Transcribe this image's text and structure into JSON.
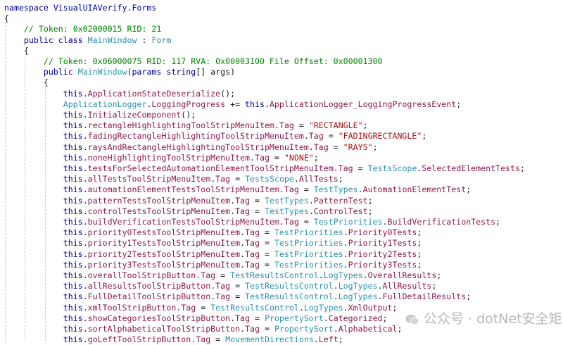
{
  "colors": {
    "keyword": "#00008b",
    "comment": "#008000",
    "type": "#2b91af",
    "namespace_type": "#0000a0",
    "member": "#8b1a4b",
    "string": "#a31515",
    "background": "#ffffff",
    "watermark": "#b8b8b8"
  },
  "watermark": {
    "icon": "wechat-icon",
    "text": "公众号 · dotNet安全矩阵"
  },
  "lines": [
    [
      [
        "kw",
        "namespace"
      ],
      [
        "p",
        " "
      ],
      [
        "tp",
        "VisualUIAVerify.Forms"
      ]
    ],
    [
      [
        "p",
        "{"
      ]
    ],
    [
      [
        "p",
        "    "
      ],
      [
        "cmt",
        "// Token: 0x02000015 RID: 21"
      ]
    ],
    [
      [
        "p",
        "    "
      ],
      [
        "kw",
        "public class"
      ],
      [
        "p",
        " "
      ],
      [
        "ty",
        "MainWindow"
      ],
      [
        "p",
        " : "
      ],
      [
        "ty",
        "Form"
      ]
    ],
    [
      [
        "p",
        "    {"
      ]
    ],
    [
      [
        "p",
        "        "
      ],
      [
        "cmt",
        "// Token: 0x06000075 RID: 117 RVA: 0x00003100 File Offset: 0x00001300"
      ]
    ],
    [
      [
        "p",
        "        "
      ],
      [
        "kw",
        "public"
      ],
      [
        "p",
        " "
      ],
      [
        "ty",
        "MainWindow"
      ],
      [
        "p",
        "("
      ],
      [
        "kw",
        "params string"
      ],
      [
        "p",
        "[] args)"
      ]
    ],
    [
      [
        "p",
        "        {"
      ]
    ],
    [
      [
        "p",
        "            "
      ],
      [
        "kw",
        "this"
      ],
      [
        "p",
        "."
      ],
      [
        "mem",
        "ApplicationStateDeserialize"
      ],
      [
        "p",
        "();"
      ]
    ],
    [
      [
        "p",
        "            "
      ],
      [
        "ty",
        "ApplicationLogger"
      ],
      [
        "p",
        "."
      ],
      [
        "mem",
        "LoggingProgress"
      ],
      [
        "p",
        " += "
      ],
      [
        "kw",
        "this"
      ],
      [
        "p",
        "."
      ],
      [
        "mem",
        "ApplicationLogger_LoggingProgressEvent"
      ],
      [
        "p",
        ";"
      ]
    ],
    [
      [
        "p",
        "            "
      ],
      [
        "kw",
        "this"
      ],
      [
        "p",
        "."
      ],
      [
        "mem",
        "InitializeComponent"
      ],
      [
        "p",
        "();"
      ]
    ],
    [
      [
        "p",
        "            "
      ],
      [
        "kw",
        "this"
      ],
      [
        "p",
        "."
      ],
      [
        "mem",
        "rectangleHighlightingToolStripMenuItem"
      ],
      [
        "p",
        "."
      ],
      [
        "mem",
        "Tag"
      ],
      [
        "p",
        " = "
      ],
      [
        "str",
        "\"RECTANGLE\""
      ],
      [
        "p",
        ";"
      ]
    ],
    [
      [
        "p",
        "            "
      ],
      [
        "kw",
        "this"
      ],
      [
        "p",
        "."
      ],
      [
        "mem",
        "fadingRectangleHighlightingToolStripMenuItem"
      ],
      [
        "p",
        "."
      ],
      [
        "mem",
        "Tag"
      ],
      [
        "p",
        " = "
      ],
      [
        "str",
        "\"FADINGRECTANGLE\""
      ],
      [
        "p",
        ";"
      ]
    ],
    [
      [
        "p",
        "            "
      ],
      [
        "kw",
        "this"
      ],
      [
        "p",
        "."
      ],
      [
        "mem",
        "raysAndRectangleHighlightingToolStripMenuItem"
      ],
      [
        "p",
        "."
      ],
      [
        "mem",
        "Tag"
      ],
      [
        "p",
        " = "
      ],
      [
        "str",
        "\"RAYS\""
      ],
      [
        "p",
        ";"
      ]
    ],
    [
      [
        "p",
        "            "
      ],
      [
        "kw",
        "this"
      ],
      [
        "p",
        "."
      ],
      [
        "mem",
        "noneHighlightingToolStripMenuItem"
      ],
      [
        "p",
        "."
      ],
      [
        "mem",
        "Tag"
      ],
      [
        "p",
        " = "
      ],
      [
        "str",
        "\"NONE\""
      ],
      [
        "p",
        ";"
      ]
    ],
    [
      [
        "p",
        "            "
      ],
      [
        "kw",
        "this"
      ],
      [
        "p",
        "."
      ],
      [
        "mem",
        "testsForSelectedAutomationElementToolStripMenuItem"
      ],
      [
        "p",
        "."
      ],
      [
        "mem",
        "Tag"
      ],
      [
        "p",
        " = "
      ],
      [
        "ty",
        "TestsScope"
      ],
      [
        "p",
        "."
      ],
      [
        "mem",
        "SelectedElementTests"
      ],
      [
        "p",
        ";"
      ]
    ],
    [
      [
        "p",
        "            "
      ],
      [
        "kw",
        "this"
      ],
      [
        "p",
        "."
      ],
      [
        "mem",
        "allTestsToolStripMenuItem"
      ],
      [
        "p",
        "."
      ],
      [
        "mem",
        "Tag"
      ],
      [
        "p",
        " = "
      ],
      [
        "ty",
        "TestsScope"
      ],
      [
        "p",
        "."
      ],
      [
        "mem",
        "AllTests"
      ],
      [
        "p",
        ";"
      ]
    ],
    [
      [
        "p",
        "            "
      ],
      [
        "kw",
        "this"
      ],
      [
        "p",
        "."
      ],
      [
        "mem",
        "automationElementTestsToolStripMenuItem"
      ],
      [
        "p",
        "."
      ],
      [
        "mem",
        "Tag"
      ],
      [
        "p",
        " = "
      ],
      [
        "ty",
        "TestTypes"
      ],
      [
        "p",
        "."
      ],
      [
        "mem",
        "AutomationElementTest"
      ],
      [
        "p",
        ";"
      ]
    ],
    [
      [
        "p",
        "            "
      ],
      [
        "kw",
        "this"
      ],
      [
        "p",
        "."
      ],
      [
        "mem",
        "patternTestsToolStripMenuItem"
      ],
      [
        "p",
        "."
      ],
      [
        "mem",
        "Tag"
      ],
      [
        "p",
        " = "
      ],
      [
        "ty",
        "TestTypes"
      ],
      [
        "p",
        "."
      ],
      [
        "mem",
        "PatternTest"
      ],
      [
        "p",
        ";"
      ]
    ],
    [
      [
        "p",
        "            "
      ],
      [
        "kw",
        "this"
      ],
      [
        "p",
        "."
      ],
      [
        "mem",
        "controlTestsToolStripMenuItem"
      ],
      [
        "p",
        "."
      ],
      [
        "mem",
        "Tag"
      ],
      [
        "p",
        " = "
      ],
      [
        "ty",
        "TestTypes"
      ],
      [
        "p",
        "."
      ],
      [
        "mem",
        "ControlTest"
      ],
      [
        "p",
        ";"
      ]
    ],
    [
      [
        "p",
        "            "
      ],
      [
        "kw",
        "this"
      ],
      [
        "p",
        "."
      ],
      [
        "mem",
        "buildVerificationTestsToolStripMenuItem"
      ],
      [
        "p",
        "."
      ],
      [
        "mem",
        "Tag"
      ],
      [
        "p",
        " = "
      ],
      [
        "ty",
        "TestPriorities"
      ],
      [
        "p",
        "."
      ],
      [
        "mem",
        "BuildVerificationTests"
      ],
      [
        "p",
        ";"
      ]
    ],
    [
      [
        "p",
        "            "
      ],
      [
        "kw",
        "this"
      ],
      [
        "p",
        "."
      ],
      [
        "mem",
        "priority0TestsToolStripMenuItem"
      ],
      [
        "p",
        "."
      ],
      [
        "mem",
        "Tag"
      ],
      [
        "p",
        " = "
      ],
      [
        "ty",
        "TestPriorities"
      ],
      [
        "p",
        "."
      ],
      [
        "mem",
        "Priority0Tests"
      ],
      [
        "p",
        ";"
      ]
    ],
    [
      [
        "p",
        "            "
      ],
      [
        "kw",
        "this"
      ],
      [
        "p",
        "."
      ],
      [
        "mem",
        "priority1TestsToolStripMenuItem"
      ],
      [
        "p",
        "."
      ],
      [
        "mem",
        "Tag"
      ],
      [
        "p",
        " = "
      ],
      [
        "ty",
        "TestPriorities"
      ],
      [
        "p",
        "."
      ],
      [
        "mem",
        "Priority1Tests"
      ],
      [
        "p",
        ";"
      ]
    ],
    [
      [
        "p",
        "            "
      ],
      [
        "kw",
        "this"
      ],
      [
        "p",
        "."
      ],
      [
        "mem",
        "priority2TestsToolStripMenuItem"
      ],
      [
        "p",
        "."
      ],
      [
        "mem",
        "Tag"
      ],
      [
        "p",
        " = "
      ],
      [
        "ty",
        "TestPriorities"
      ],
      [
        "p",
        "."
      ],
      [
        "mem",
        "Priority2Tests"
      ],
      [
        "p",
        ";"
      ]
    ],
    [
      [
        "p",
        "            "
      ],
      [
        "kw",
        "this"
      ],
      [
        "p",
        "."
      ],
      [
        "mem",
        "priority3TestsToolStripMenuItem"
      ],
      [
        "p",
        "."
      ],
      [
        "mem",
        "Tag"
      ],
      [
        "p",
        " = "
      ],
      [
        "ty",
        "TestPriorities"
      ],
      [
        "p",
        "."
      ],
      [
        "mem",
        "Priority3Tests"
      ],
      [
        "p",
        ";"
      ]
    ],
    [
      [
        "p",
        "            "
      ],
      [
        "kw",
        "this"
      ],
      [
        "p",
        "."
      ],
      [
        "mem",
        "overallToolStripButton"
      ],
      [
        "p",
        "."
      ],
      [
        "mem",
        "Tag"
      ],
      [
        "p",
        " = "
      ],
      [
        "ty",
        "TestResultsControl"
      ],
      [
        "p",
        "."
      ],
      [
        "ty",
        "LogTypes"
      ],
      [
        "p",
        "."
      ],
      [
        "mem",
        "OverallResults"
      ],
      [
        "p",
        ";"
      ]
    ],
    [
      [
        "p",
        "            "
      ],
      [
        "kw",
        "this"
      ],
      [
        "p",
        "."
      ],
      [
        "mem",
        "allResultsToolStripButton"
      ],
      [
        "p",
        "."
      ],
      [
        "mem",
        "Tag"
      ],
      [
        "p",
        " = "
      ],
      [
        "ty",
        "TestResultsControl"
      ],
      [
        "p",
        "."
      ],
      [
        "ty",
        "LogTypes"
      ],
      [
        "p",
        "."
      ],
      [
        "mem",
        "AllResults"
      ],
      [
        "p",
        ";"
      ]
    ],
    [
      [
        "p",
        "            "
      ],
      [
        "kw",
        "this"
      ],
      [
        "p",
        "."
      ],
      [
        "mem",
        "FullDetailToolStripButton"
      ],
      [
        "p",
        "."
      ],
      [
        "mem",
        "Tag"
      ],
      [
        "p",
        " = "
      ],
      [
        "ty",
        "TestResultsControl"
      ],
      [
        "p",
        "."
      ],
      [
        "ty",
        "LogTypes"
      ],
      [
        "p",
        "."
      ],
      [
        "mem",
        "FullDetailResults"
      ],
      [
        "p",
        ";"
      ]
    ],
    [
      [
        "p",
        "            "
      ],
      [
        "kw",
        "this"
      ],
      [
        "p",
        "."
      ],
      [
        "mem",
        "xmlToolStripButton"
      ],
      [
        "p",
        "."
      ],
      [
        "mem",
        "Tag"
      ],
      [
        "p",
        " = "
      ],
      [
        "ty",
        "TestResultsControl"
      ],
      [
        "p",
        "."
      ],
      [
        "ty",
        "LogTypes"
      ],
      [
        "p",
        "."
      ],
      [
        "mem",
        "XmlOutput"
      ],
      [
        "p",
        ";"
      ]
    ],
    [
      [
        "p",
        "            "
      ],
      [
        "kw",
        "this"
      ],
      [
        "p",
        "."
      ],
      [
        "mem",
        "showCategoriesToolStripButton"
      ],
      [
        "p",
        "."
      ],
      [
        "mem",
        "Tag"
      ],
      [
        "p",
        " = "
      ],
      [
        "ty",
        "PropertySort"
      ],
      [
        "p",
        "."
      ],
      [
        "mem",
        "Categorized"
      ],
      [
        "p",
        ";"
      ]
    ],
    [
      [
        "p",
        "            "
      ],
      [
        "kw",
        "this"
      ],
      [
        "p",
        "."
      ],
      [
        "mem",
        "sortAlphabeticalToolStripButton"
      ],
      [
        "p",
        "."
      ],
      [
        "mem",
        "Tag"
      ],
      [
        "p",
        " = "
      ],
      [
        "ty",
        "PropertySort"
      ],
      [
        "p",
        "."
      ],
      [
        "mem",
        "Alphabetical"
      ],
      [
        "p",
        ";"
      ]
    ],
    [
      [
        "p",
        "            "
      ],
      [
        "kw",
        "this"
      ],
      [
        "p",
        "."
      ],
      [
        "mem",
        "goLeftToolStripButton"
      ],
      [
        "p",
        "."
      ],
      [
        "mem",
        "Tag"
      ],
      [
        "p",
        " = "
      ],
      [
        "ty",
        "MovementDirections"
      ],
      [
        "p",
        "."
      ],
      [
        "mem",
        "Left"
      ],
      [
        "p",
        ";"
      ]
    ]
  ]
}
